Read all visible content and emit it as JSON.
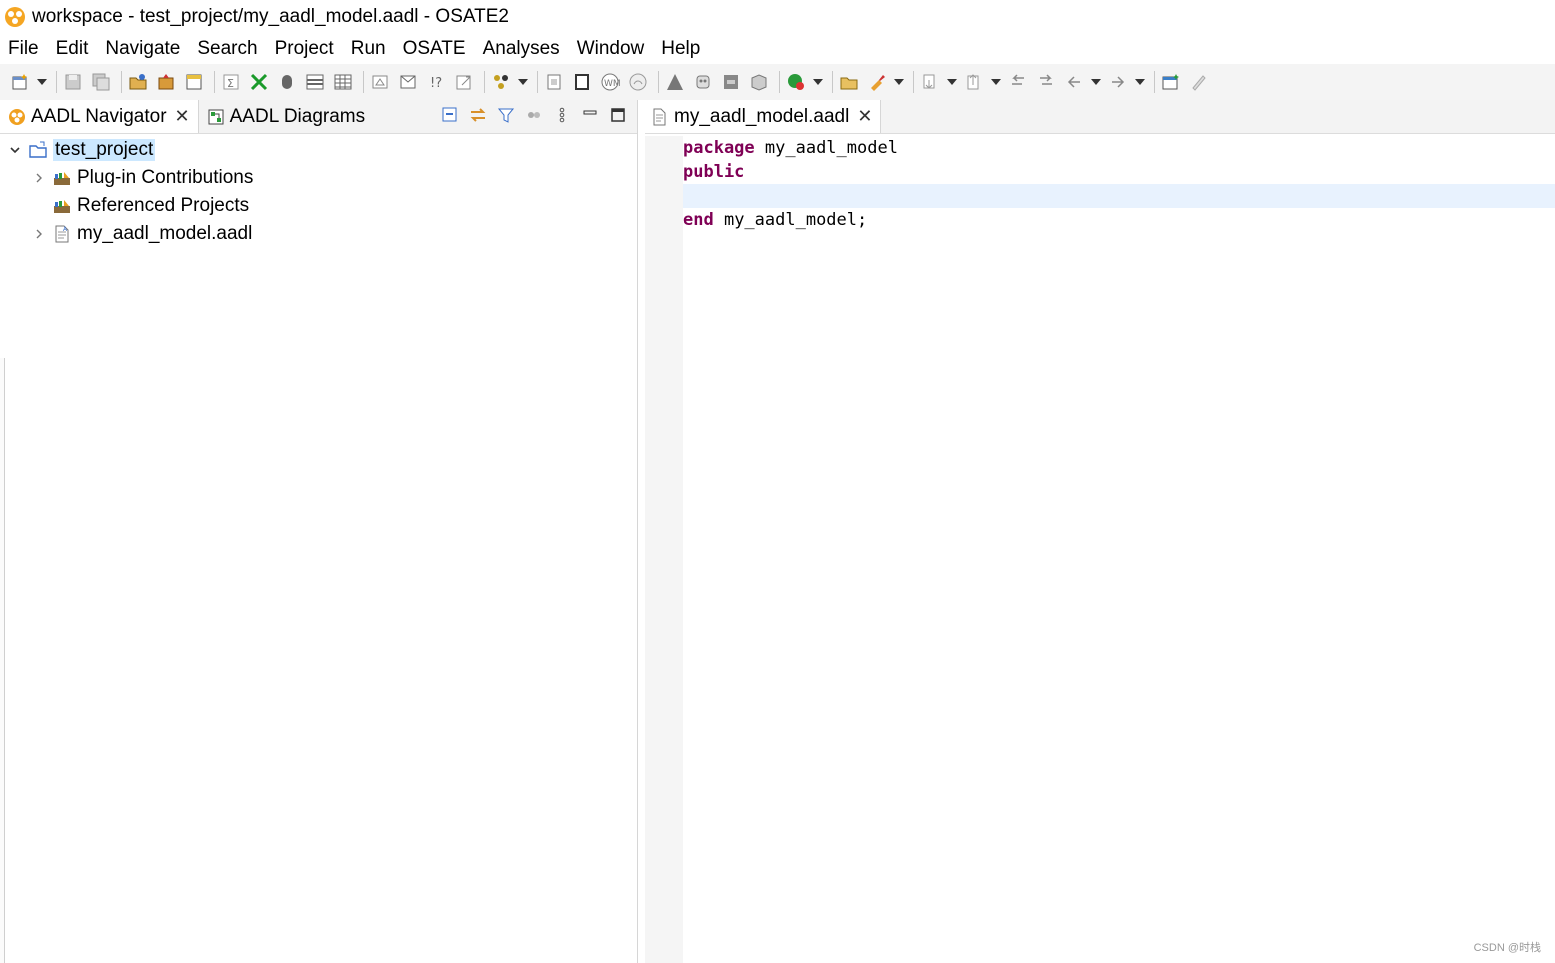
{
  "window": {
    "title": "workspace - test_project/my_aadl_model.aadl - OSATE2"
  },
  "menu": [
    "File",
    "Edit",
    "Navigate",
    "Search",
    "Project",
    "Run",
    "OSATE",
    "Analyses",
    "Window",
    "Help"
  ],
  "left_panel": {
    "tabs": [
      {
        "label": "AADL Navigator",
        "closable": true,
        "active": true
      },
      {
        "label": "AADL Diagrams",
        "closable": false,
        "active": false
      }
    ],
    "tree": [
      {
        "label": "test_project",
        "level": 0,
        "expanded": true,
        "selected": true
      },
      {
        "label": "Plug-in Contributions",
        "level": 1,
        "expandable": true
      },
      {
        "label": "Referenced Projects",
        "level": 1,
        "expandable": false
      },
      {
        "label": "my_aadl_model.aadl",
        "level": 1,
        "expandable": true
      }
    ]
  },
  "editor": {
    "tab_label": "my_aadl_model.aadl",
    "lines": [
      {
        "keyword": "package",
        "text": " my_aadl_model"
      },
      {
        "keyword": "public",
        "text": ""
      },
      {
        "keyword": "",
        "text": ""
      },
      {
        "keyword": "end",
        "text": " my_aadl_model;"
      }
    ]
  },
  "watermark": "CSDN @时栈",
  "colors": {
    "keyword": "#7f0055",
    "selection": "#cce8ff",
    "current_line": "#e8f2fe"
  }
}
